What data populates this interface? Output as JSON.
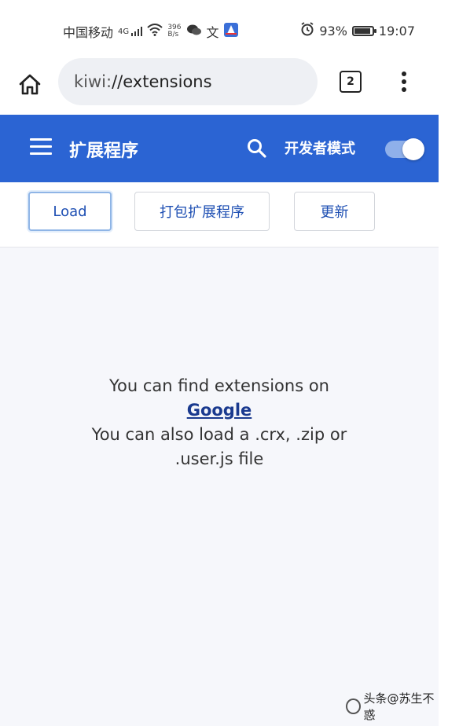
{
  "status_bar": {
    "carrier": "中国移动",
    "signal": "4G",
    "net_speed_value": "396",
    "net_speed_unit": "B/s",
    "battery_percent": "93%",
    "battery_level": 0.93,
    "time": "19:07"
  },
  "address_bar": {
    "url_scheme": "kiwi:",
    "url_path": "//extensions",
    "tab_count": "2"
  },
  "header": {
    "title": "扩展程序",
    "dev_mode_label": "开发者模式",
    "dev_mode_enabled": true,
    "accent_color": "#2b64d3"
  },
  "toolbar": {
    "load_label": "Load",
    "pack_label": "打包扩展程序",
    "update_label": "更新"
  },
  "empty_state": {
    "line1": "You can find extensions on",
    "link": "Google",
    "line2": "You can also load a .crx, .zip or",
    "line3": ".user.js file"
  },
  "watermark": {
    "text": "头条@苏生不惑"
  },
  "icons": {
    "home": "home-icon",
    "menu": "more-vertical-icon",
    "drawer": "hamburger-menu-icon",
    "search": "search-icon"
  }
}
